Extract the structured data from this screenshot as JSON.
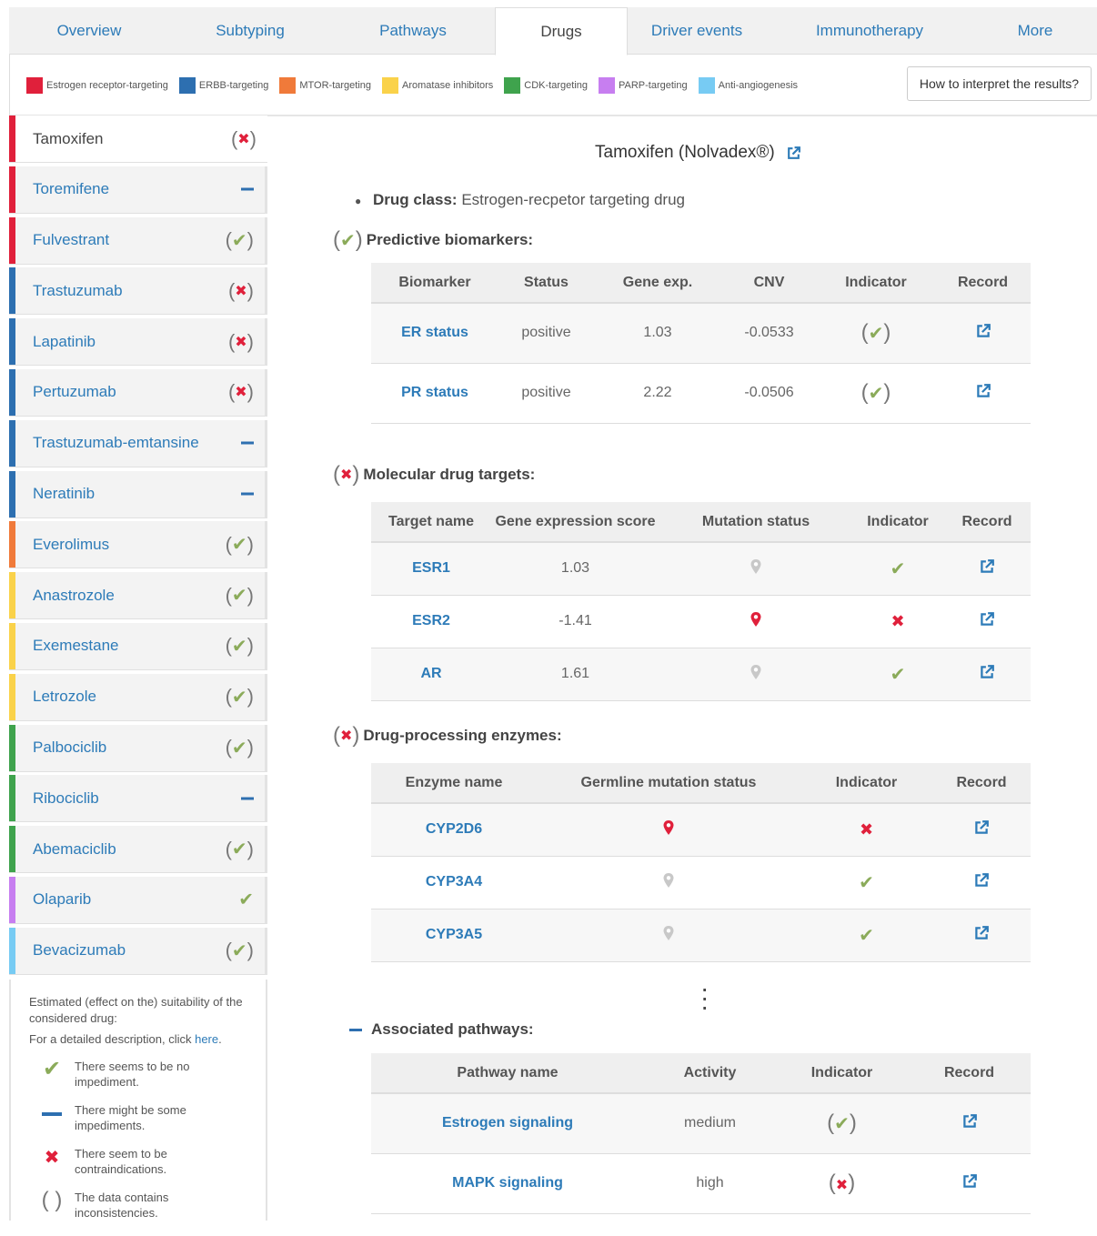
{
  "tabs": [
    {
      "label": "Overview",
      "active": false
    },
    {
      "label": "Subtyping",
      "active": false
    },
    {
      "label": "Pathways",
      "active": false
    },
    {
      "label": "Drugs",
      "active": true
    },
    {
      "label": "Driver events",
      "active": false
    },
    {
      "label": "Immunotherapy",
      "active": false
    },
    {
      "label": "More",
      "active": false
    }
  ],
  "legend": [
    {
      "label": "Estrogen receptor-targeting",
      "color": "#e0203b"
    },
    {
      "label": "ERBB-targeting",
      "color": "#2d6fb0"
    },
    {
      "label": "MTOR-targeting",
      "color": "#f07a3a"
    },
    {
      "label": "Aromatase inhibitors",
      "color": "#fad24a"
    },
    {
      "label": "CDK-targeting",
      "color": "#3fa34d"
    },
    {
      "label": "PARP-targeting",
      "color": "#c77ef0"
    },
    {
      "label": "Anti-angiogenesis",
      "color": "#77cbf3"
    }
  ],
  "howto_label": "How to interpret the results?",
  "drugs": [
    {
      "name": "Tamoxifen",
      "color": "#e0203b",
      "indicator": "cross-paren",
      "active": true
    },
    {
      "name": "Toremifene",
      "color": "#e0203b",
      "indicator": "dash"
    },
    {
      "name": "Fulvestrant",
      "color": "#e0203b",
      "indicator": "check-paren"
    },
    {
      "name": "Trastuzumab",
      "color": "#2d6fb0",
      "indicator": "cross-paren"
    },
    {
      "name": "Lapatinib",
      "color": "#2d6fb0",
      "indicator": "cross-paren"
    },
    {
      "name": "Pertuzumab",
      "color": "#2d6fb0",
      "indicator": "cross-paren"
    },
    {
      "name": "Trastuzumab-emtansine",
      "color": "#2d6fb0",
      "indicator": "dash"
    },
    {
      "name": "Neratinib",
      "color": "#2d6fb0",
      "indicator": "dash"
    },
    {
      "name": "Everolimus",
      "color": "#f07a3a",
      "indicator": "check-paren"
    },
    {
      "name": "Anastrozole",
      "color": "#fad24a",
      "indicator": "check-paren"
    },
    {
      "name": "Exemestane",
      "color": "#fad24a",
      "indicator": "check-paren"
    },
    {
      "name": "Letrozole",
      "color": "#fad24a",
      "indicator": "check-paren"
    },
    {
      "name": "Palbociclib",
      "color": "#3fa34d",
      "indicator": "check-paren"
    },
    {
      "name": "Ribociclib",
      "color": "#3fa34d",
      "indicator": "dash"
    },
    {
      "name": "Abemaciclib",
      "color": "#3fa34d",
      "indicator": "check-paren"
    },
    {
      "name": "Olaparib",
      "color": "#c77ef0",
      "indicator": "check"
    },
    {
      "name": "Bevacizumab",
      "color": "#77cbf3",
      "indicator": "check-paren"
    }
  ],
  "sidebar_legend": {
    "intro": "Estimated (effect on the) suitability of the considered drug:",
    "detail_prefix": "For a detailed description, click ",
    "detail_link": "here",
    "detail_suffix": ".",
    "rows": [
      {
        "icon": "check",
        "text": "There seems to be no impediment."
      },
      {
        "icon": "dash",
        "text": "There might be some impediments."
      },
      {
        "icon": "cross",
        "text": "There seem to be contraindications."
      },
      {
        "icon": "paren",
        "symbol": "( )",
        "text": "The data contains inconsistencies."
      }
    ]
  },
  "main": {
    "title": "Tamoxifen (Nolvadex®)",
    "drug_class_label": "Drug class:",
    "drug_class_value": "Estrogen-recpetor targeting drug",
    "biomarkers": {
      "heading": "Predictive biomarkers:",
      "heading_indicator": "check-paren",
      "columns": [
        "Biomarker",
        "Status",
        "Gene exp.",
        "CNV",
        "Indicator",
        "Record"
      ],
      "rows": [
        {
          "name": "ER status",
          "status": "positive",
          "gene_exp": "1.03",
          "cnv": "-0.0533",
          "indicator": "check-paren"
        },
        {
          "name": "PR status",
          "status": "positive",
          "gene_exp": "2.22",
          "cnv": "-0.0506",
          "indicator": "check-paren"
        }
      ]
    },
    "targets": {
      "heading": "Molecular drug targets:",
      "heading_indicator": "cross-paren",
      "columns": [
        "Target name",
        "Gene expression score",
        "Mutation status",
        "Indicator",
        "Record"
      ],
      "rows": [
        {
          "name": "ESR1",
          "score": "1.03",
          "mutation": "grey",
          "indicator": "check"
        },
        {
          "name": "ESR2",
          "score": "-1.41",
          "mutation": "red",
          "indicator": "cross"
        },
        {
          "name": "AR",
          "score": "1.61",
          "mutation": "grey",
          "indicator": "check"
        }
      ]
    },
    "enzymes": {
      "heading": "Drug-processing enzymes:",
      "heading_indicator": "cross-paren",
      "columns": [
        "Enzyme name",
        "Germline mutation status",
        "Indicator",
        "Record"
      ],
      "rows": [
        {
          "name": "CYP2D6",
          "mutation": "red",
          "indicator": "cross"
        },
        {
          "name": "CYP3A4",
          "mutation": "grey",
          "indicator": "check"
        },
        {
          "name": "CYP3A5",
          "mutation": "grey",
          "indicator": "check"
        }
      ]
    },
    "pathways": {
      "heading": "Associated pathways:",
      "heading_indicator": "dash",
      "columns": [
        "Pathway name",
        "Activity",
        "Indicator",
        "Record"
      ],
      "rows": [
        {
          "name": "Estrogen signaling",
          "activity": "medium",
          "indicator": "check-paren"
        },
        {
          "name": "MAPK signaling",
          "activity": "high",
          "indicator": "cross-paren"
        }
      ]
    }
  }
}
